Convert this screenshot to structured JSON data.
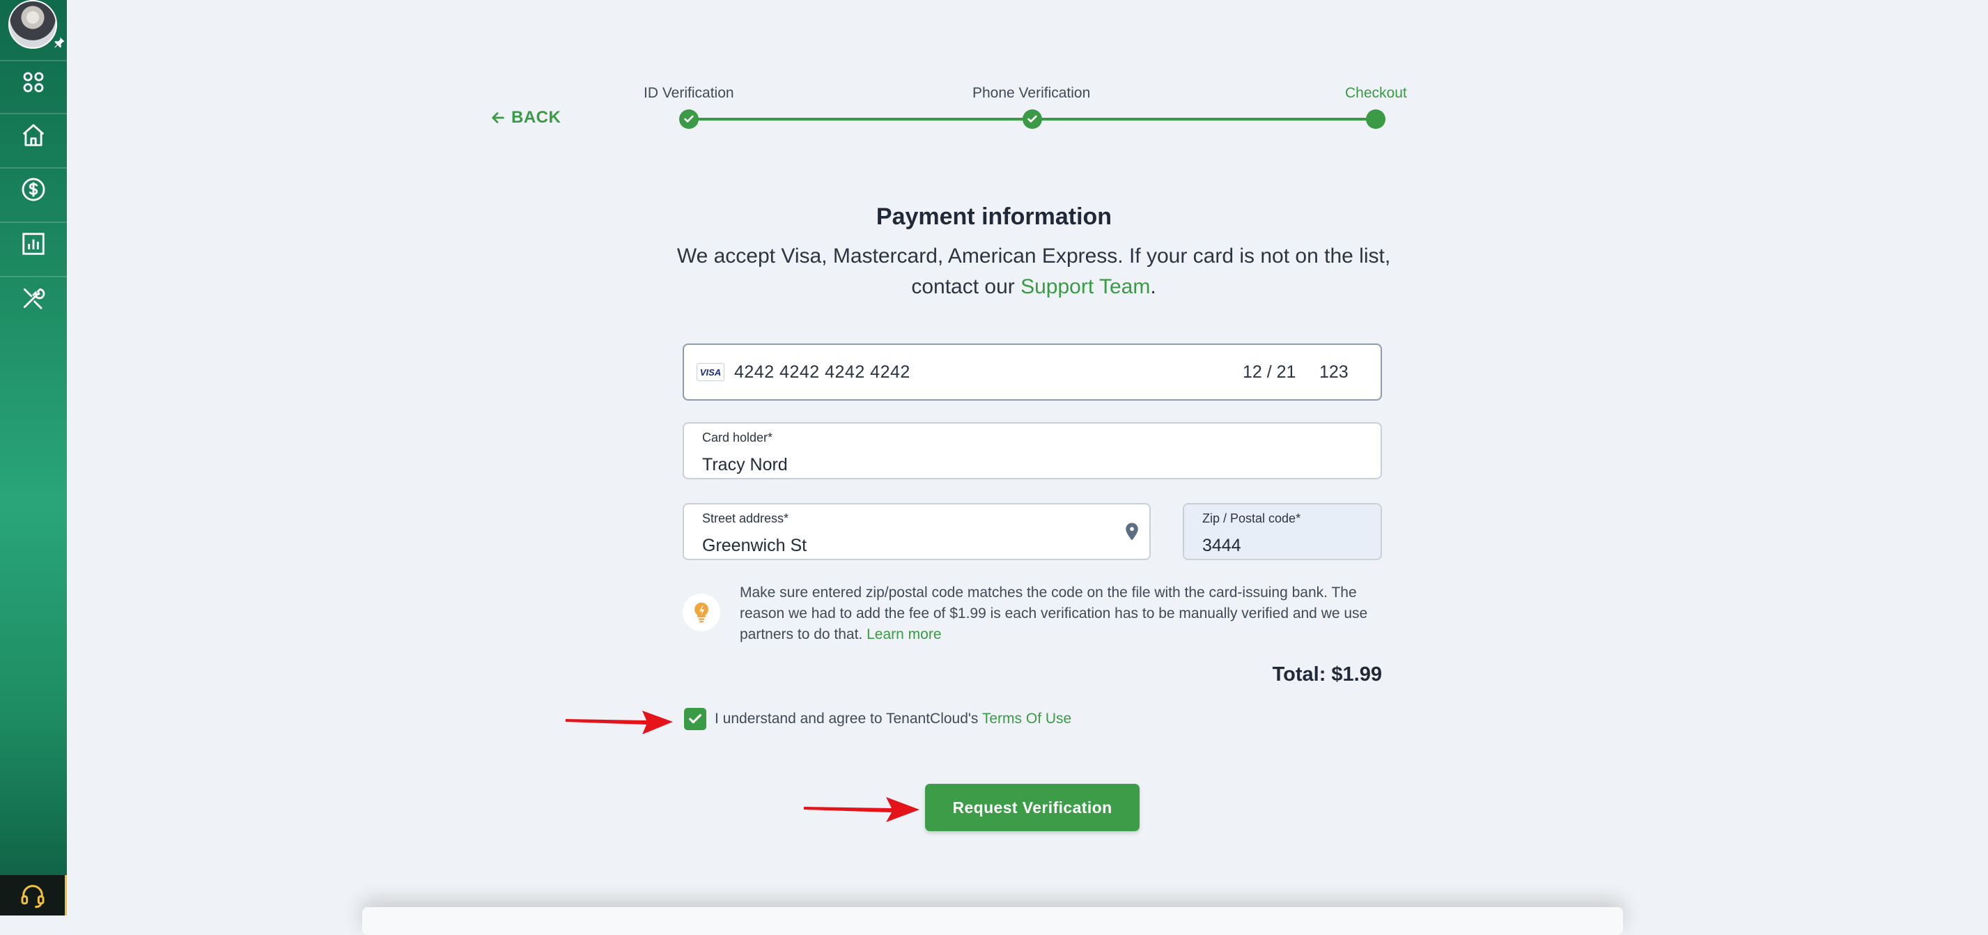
{
  "sidebar": {
    "items": [
      {
        "icon": "apps-grid-icon"
      },
      {
        "icon": "home-icon"
      },
      {
        "icon": "dollar-circle-icon"
      },
      {
        "icon": "bar-chart-icon"
      },
      {
        "icon": "tools-icon"
      }
    ],
    "support_icon": "headset-icon"
  },
  "stepper": {
    "back_label": "BACK",
    "steps": [
      {
        "label": "ID Verification",
        "state": "done"
      },
      {
        "label": "Phone Verification",
        "state": "done"
      },
      {
        "label": "Checkout",
        "state": "current"
      }
    ]
  },
  "payment": {
    "title": "Payment information",
    "subtitle_pre": "We accept Visa, Mastercard, American Express. If your card is not on the list, contact our",
    "support_link": "Support Team",
    "subtitle_post": ".",
    "card": {
      "brand": "VISA",
      "number": "4242 4242 4242 4242",
      "expiry": "12 / 21",
      "cvc": "123"
    },
    "card_holder": {
      "label": "Card holder*",
      "value": "Tracy Nord"
    },
    "street": {
      "label": "Street address*",
      "value": "Greenwich St"
    },
    "zip": {
      "label": "Zip / Postal code*",
      "value": "3444"
    },
    "info_text": "Make sure entered zip/postal code matches the code on the file with the card-issuing bank. The reason we had to add the fee of $1.99 is each verification has to be manually verified and we use partners to do that.",
    "learn_more": "Learn more",
    "total": "Total: $1.99",
    "terms_text": "I understand and agree to TenantCloud's",
    "terms_link": "Terms Of Use",
    "terms_checked": true,
    "submit_label": "Request Verification"
  },
  "colors": {
    "accent": "#3a9a46",
    "annotation_arrow": "#e5141b"
  }
}
